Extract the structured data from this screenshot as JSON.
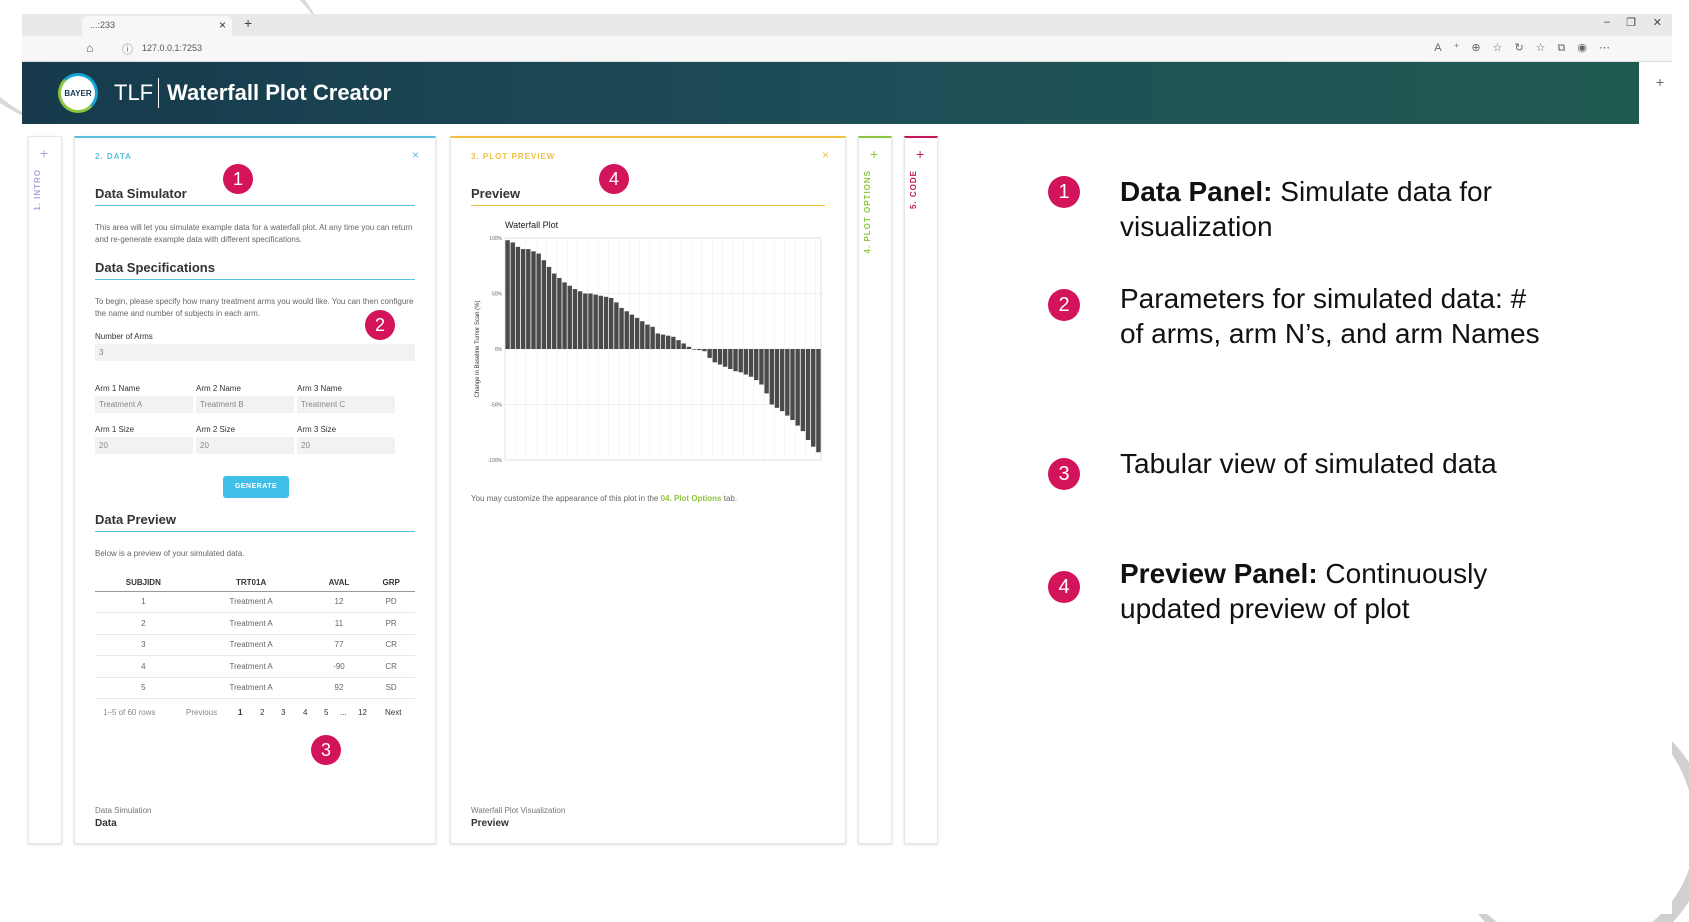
{
  "browser": {
    "tab_title": "...:233",
    "url": "127.0.0.1:7253"
  },
  "header": {
    "logo_text": "BAYER",
    "brand_short": "TLF",
    "app_title": "Waterfall Plot Creator"
  },
  "colors": {
    "header_start": "#163a4c",
    "header_end": "#1f5a50",
    "data_accent": "#5bc0de",
    "preview_accent": "#f0c040",
    "options_accent": "#8cc63f",
    "code_accent": "#c2185b",
    "intro_accent": "#b39ddb",
    "badge": "#d4145a",
    "bar": "#4a4a4a"
  },
  "panels": {
    "intro": {
      "label": "1. INTRO"
    },
    "data": {
      "label": "2. DATA",
      "simulator_title": "Data Simulator",
      "simulator_text": "This area will let you simulate example data for a waterfall plot. At any time you can return and re-generate example data with different specifications.",
      "spec_title": "Data Specifications",
      "spec_text": "To begin, please specify how many treatment arms you would like. You can then configure the name and number of subjects in each arm.",
      "num_arms_label": "Number of Arms",
      "num_arms_value": "3",
      "arm_names": [
        {
          "label": "Arm 1 Name",
          "value": "Treatment A"
        },
        {
          "label": "Arm 2 Name",
          "value": "Treatment B"
        },
        {
          "label": "Arm 3 Name",
          "value": "Treatment C"
        }
      ],
      "arm_sizes": [
        {
          "label": "Arm 1 Size",
          "value": "20"
        },
        {
          "label": "Arm 2 Size",
          "value": "20"
        },
        {
          "label": "Arm 3 Size",
          "value": "20"
        }
      ],
      "generate_label": "GENERATE",
      "preview_title": "Data Preview",
      "preview_text": "Below is a preview of your simulated data.",
      "table": {
        "headers": [
          "SUBJIDN",
          "TRT01A",
          "AVAL",
          "GRP"
        ],
        "rows": [
          [
            "1",
            "Treatment A",
            "12",
            "PD"
          ],
          [
            "2",
            "Treatment A",
            "11",
            "PR"
          ],
          [
            "3",
            "Treatment A",
            "77",
            "CR"
          ],
          [
            "4",
            "Treatment A",
            "-90",
            "CR"
          ],
          [
            "5",
            "Treatment A",
            "92",
            "SD"
          ]
        ]
      },
      "pager": {
        "summary": "1–5 of 60 rows",
        "previous": "Previous",
        "pages": [
          "1",
          "2",
          "3",
          "4",
          "5",
          "...",
          "12"
        ],
        "next": "Next"
      },
      "footer_sub": "Data Simulation",
      "footer_main": "Data"
    },
    "preview": {
      "label": "3. PLOT PREVIEW",
      "title": "Preview",
      "note_prefix": "You may customize the appearance of this plot in the ",
      "note_link": "04. Plot Options",
      "note_suffix": " tab.",
      "footer_sub": "Waterfall Plot Visualization",
      "footer_main": "Preview"
    },
    "options": {
      "label": "4. PLOT OPTIONS"
    },
    "code": {
      "label": "5. CODE"
    }
  },
  "chart_data": {
    "type": "bar",
    "title": "Waterfall Plot",
    "xlabel": "",
    "ylabel": "Change in Baseline Tumor Scan (%)",
    "ylim": [
      -100,
      100
    ],
    "ytick_labels": [
      "100%",
      "50%",
      "0%",
      "-50%",
      "-100%"
    ],
    "yticks": [
      100,
      50,
      0,
      -50,
      -100
    ],
    "grid": true,
    "values": [
      98,
      96,
      92,
      90,
      90,
      88,
      86,
      80,
      74,
      68,
      64,
      60,
      57,
      54,
      52,
      50,
      50,
      49,
      48,
      47,
      46,
      42,
      37,
      34,
      31,
      28,
      25,
      22,
      20,
      14,
      13,
      12,
      11,
      8,
      5,
      2,
      0,
      -1,
      -2,
      -8,
      -12,
      -14,
      -16,
      -18,
      -20,
      -21,
      -23,
      -25,
      -28,
      -32,
      -40,
      -50,
      -53,
      -56,
      -60,
      -64,
      -69,
      -74,
      -82,
      -88,
      -93
    ]
  },
  "legend": [
    {
      "num": "1",
      "bold": "Data Panel:",
      "text": " Simulate data for visualization"
    },
    {
      "num": "2",
      "bold": "",
      "text": "Parameters for simulated data: # of arms, arm N’s, and arm Names"
    },
    {
      "num": "3",
      "bold": "",
      "text": "Tabular view of simulated data"
    },
    {
      "num": "4",
      "bold": "Preview Panel:",
      "text": " Continuously updated preview of plot"
    }
  ],
  "badges": [
    "1",
    "2",
    "3",
    "4"
  ]
}
